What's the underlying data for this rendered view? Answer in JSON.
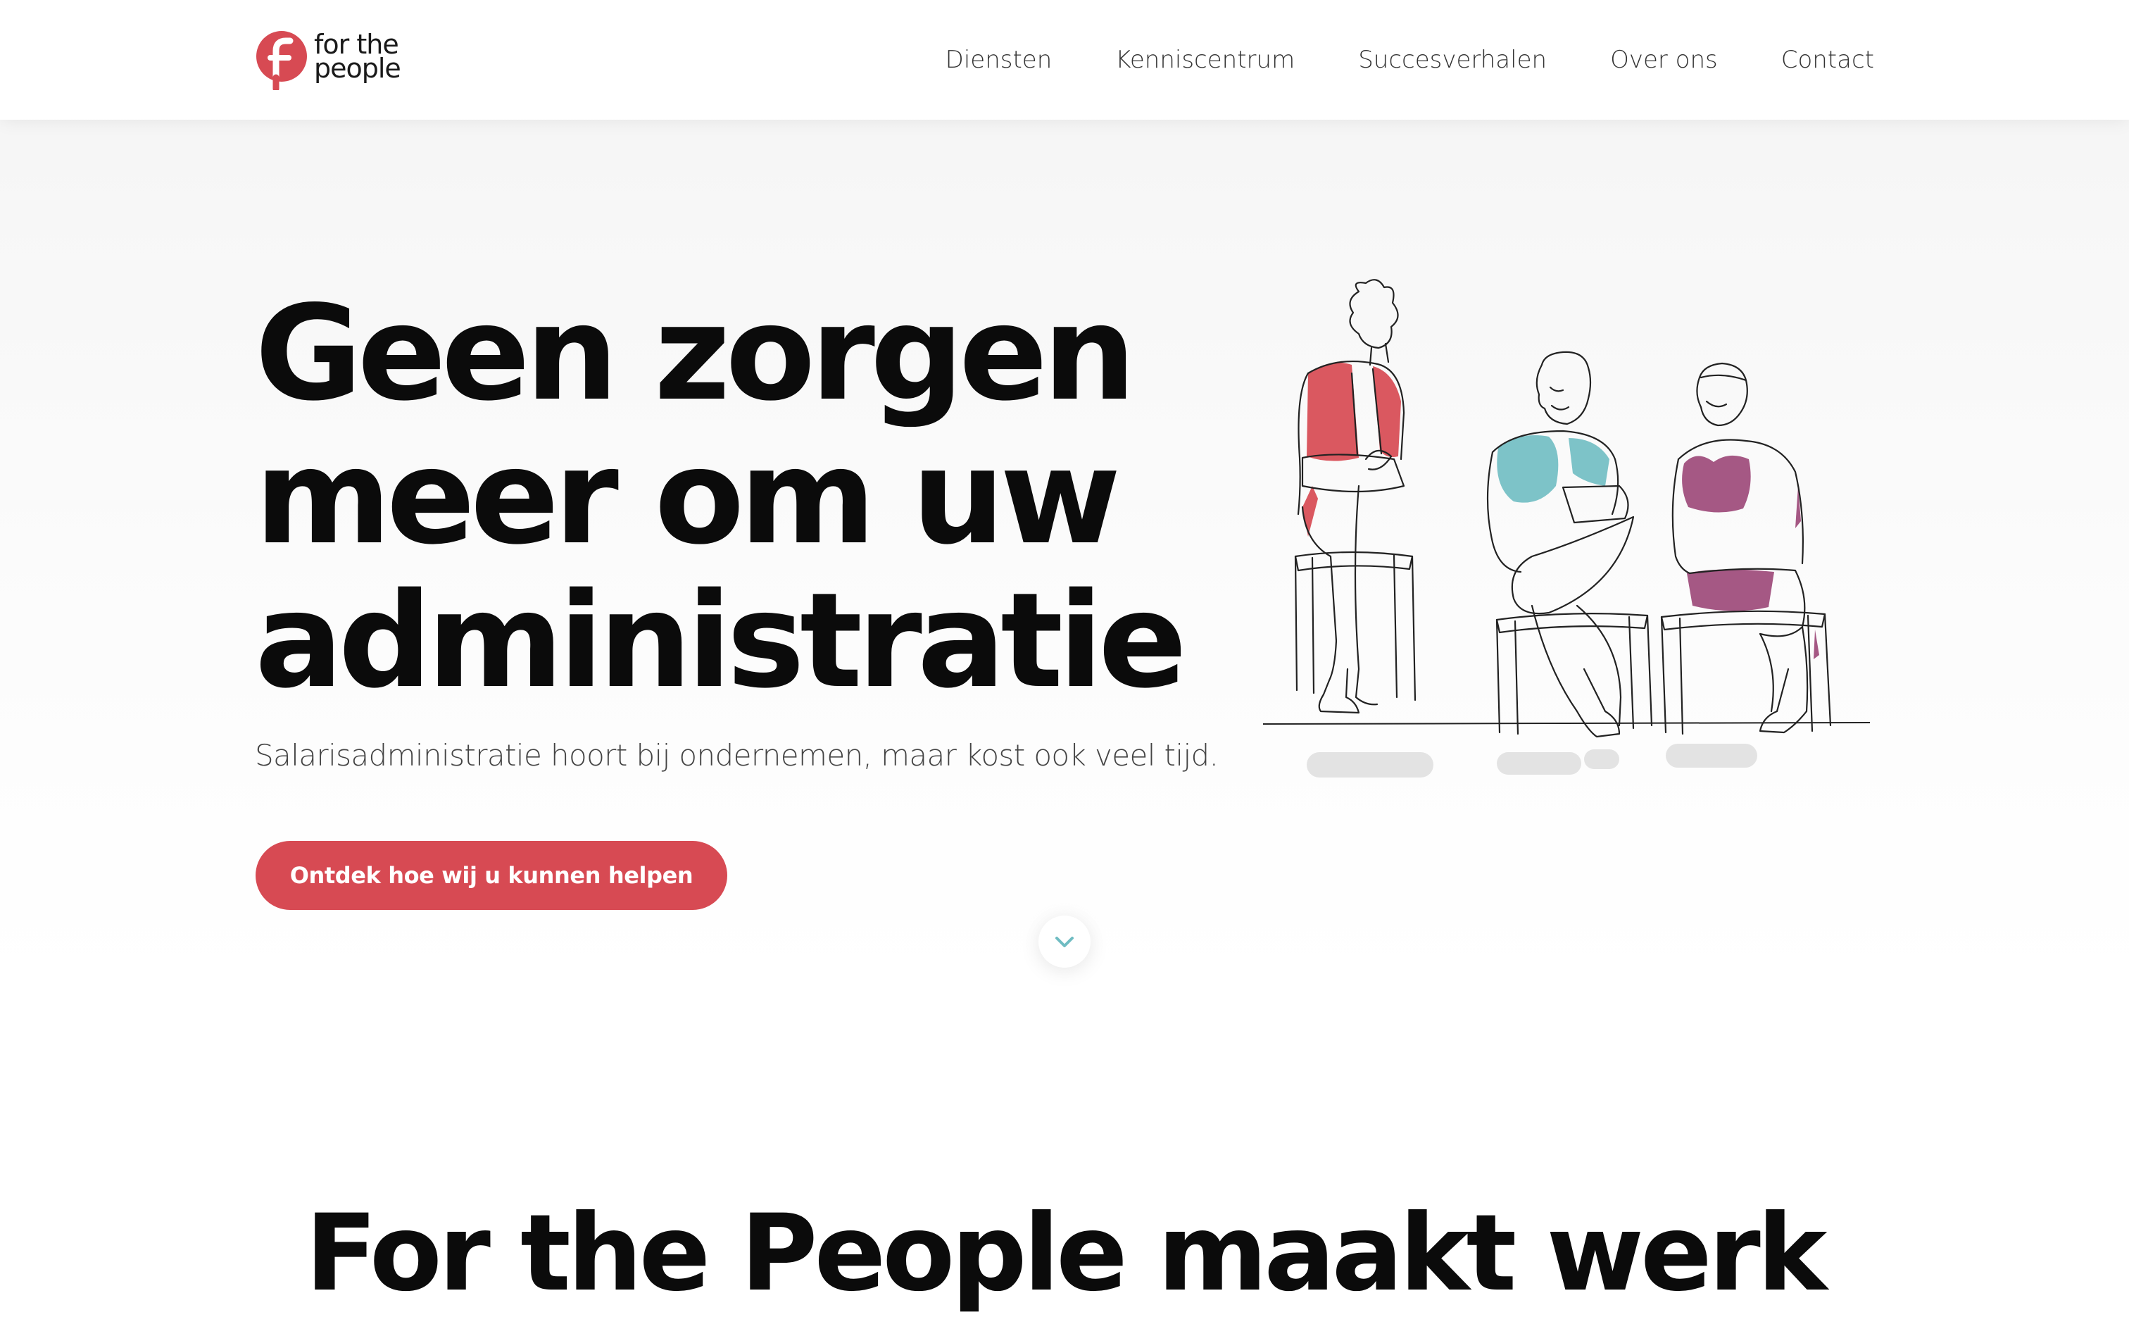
{
  "brand": {
    "logo_text_line1": "for the",
    "logo_text_line2": "people",
    "accent": "#d74a53"
  },
  "nav": {
    "items": [
      {
        "label": "Diensten"
      },
      {
        "label": "Kenniscentrum"
      },
      {
        "label": "Succesverhalen"
      },
      {
        "label": "Over ons"
      },
      {
        "label": "Contact"
      }
    ]
  },
  "hero": {
    "title_lines": [
      "Geen zorgen",
      "meer om uw",
      "administratie"
    ],
    "subtitle": "Salarisadministratie hoort bij ondernemen, maar kost ook veel tijd.",
    "cta_label": "Ontdek hoe wij u kunnen helpen",
    "scroll_icon": "chevron-down-icon",
    "illustration_colors": {
      "person1": "#d74a53",
      "person2": "#6fbcc2",
      "person3": "#9d4a7a",
      "shadow": "#e3e3e3"
    }
  },
  "next_section": {
    "heading": "For the People maakt werk"
  }
}
